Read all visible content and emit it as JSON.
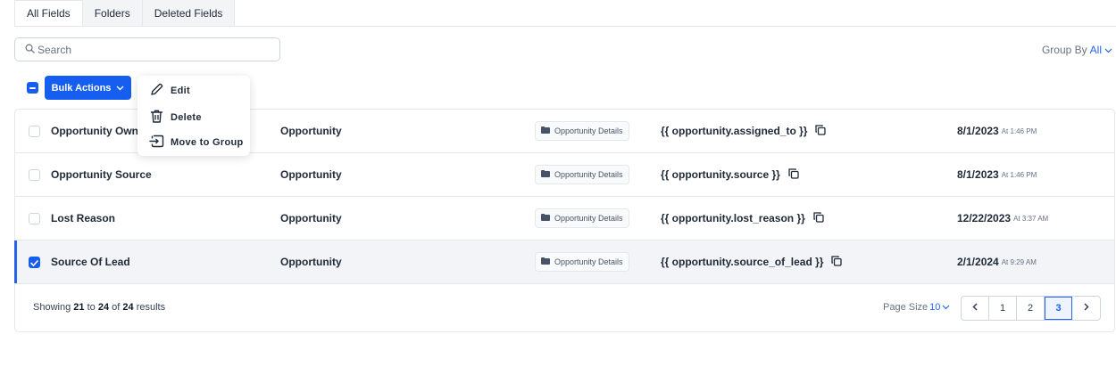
{
  "tabs": [
    {
      "label": "All Fields"
    },
    {
      "label": "Folders"
    },
    {
      "label": "Deleted Fields"
    }
  ],
  "search": {
    "placeholder": "Search"
  },
  "group_by": {
    "label": "Group By",
    "value": "All"
  },
  "bulk_actions": {
    "label": "Bulk Actions"
  },
  "menu": {
    "items": [
      {
        "label": "Edit"
      },
      {
        "label": "Delete"
      },
      {
        "label": "Move to Group"
      }
    ]
  },
  "rows": [
    {
      "name": "Opportunity Owner",
      "object": "Opportunity",
      "folder": "Opportunity Details",
      "key": "{{ opportunity.assigned_to }}",
      "date": "8/1/2023",
      "time": "At 1:46 PM",
      "checked": false
    },
    {
      "name": "Opportunity Source",
      "object": "Opportunity",
      "folder": "Opportunity Details",
      "key": "{{ opportunity.source }}",
      "date": "8/1/2023",
      "time": "At 1:46 PM",
      "checked": false
    },
    {
      "name": "Lost Reason",
      "object": "Opportunity",
      "folder": "Opportunity Details",
      "key": "{{ opportunity.lost_reason }}",
      "date": "12/22/2023",
      "time": "At 3:37 AM",
      "checked": false
    },
    {
      "name": "Source Of Lead",
      "object": "Opportunity",
      "folder": "Opportunity Details",
      "key": "{{ opportunity.source_of_lead }}",
      "date": "2/1/2024",
      "time": "At 9:29 AM",
      "checked": true
    }
  ],
  "footer": {
    "showing": "Showing",
    "from": "21",
    "to_word": "to",
    "to": "24",
    "of_word": "of",
    "total": "24",
    "results": "results",
    "page_size_label": "Page Size",
    "page_size_value": "10",
    "pages": [
      "1",
      "2",
      "3"
    ],
    "current_page": "3"
  },
  "colors": {
    "accent": "#155eef",
    "selected_row": "#f2f4f7",
    "border": "#e5e7eb"
  },
  "icons": [
    "search-icon",
    "chevron-down-icon",
    "pencil-icon",
    "trash-icon",
    "move-to-group-icon",
    "folder-icon",
    "copy-icon",
    "chevron-left-icon",
    "chevron-right-icon"
  ]
}
